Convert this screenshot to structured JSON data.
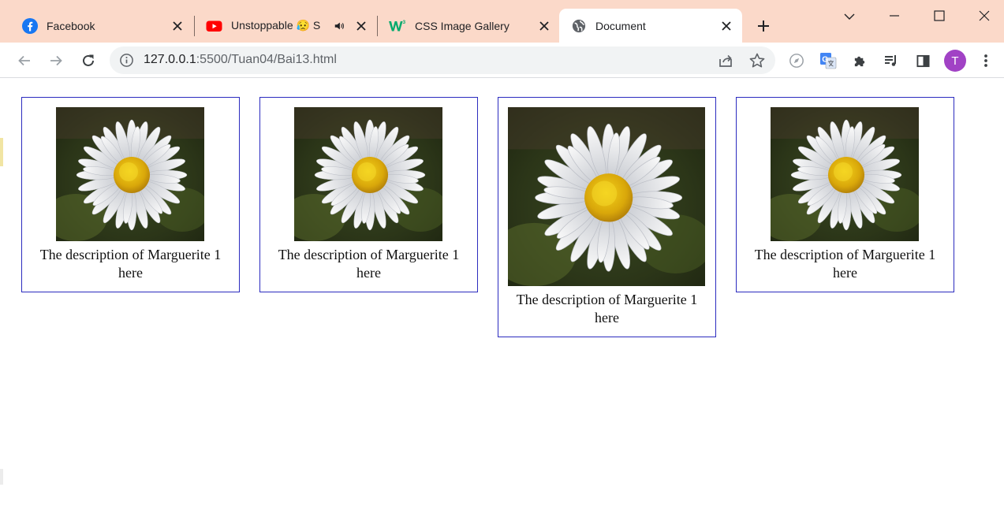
{
  "browser": {
    "tabs": [
      {
        "title": "Facebook",
        "icon": "facebook-icon",
        "active": false
      },
      {
        "title": "Unstoppable 😥 S",
        "icon": "youtube-icon",
        "active": false,
        "audio": true
      },
      {
        "title": "CSS Image Gallery",
        "icon": "w3schools-icon",
        "active": false
      },
      {
        "title": "Document",
        "icon": "globe-icon",
        "active": true
      }
    ],
    "url_host": "127.0.0.1",
    "url_rest": ":5500/Tuan04/Bai13.html",
    "profile_initial": "T",
    "colors": {
      "tabstrip": "#fbd9c9",
      "avatar": "#a142c5",
      "border": "#2b2bbf"
    }
  },
  "gallery": [
    {
      "alt": "Marguerite daisy",
      "description": "The description of Marguerite 1 here"
    },
    {
      "alt": "Marguerite daisy",
      "description": "The description of Marguerite 1 here"
    },
    {
      "alt": "Marguerite daisy",
      "description": "The description of Marguerite 1 here"
    },
    {
      "alt": "Marguerite daisy",
      "description": "The description of Marguerite 1 here"
    }
  ]
}
